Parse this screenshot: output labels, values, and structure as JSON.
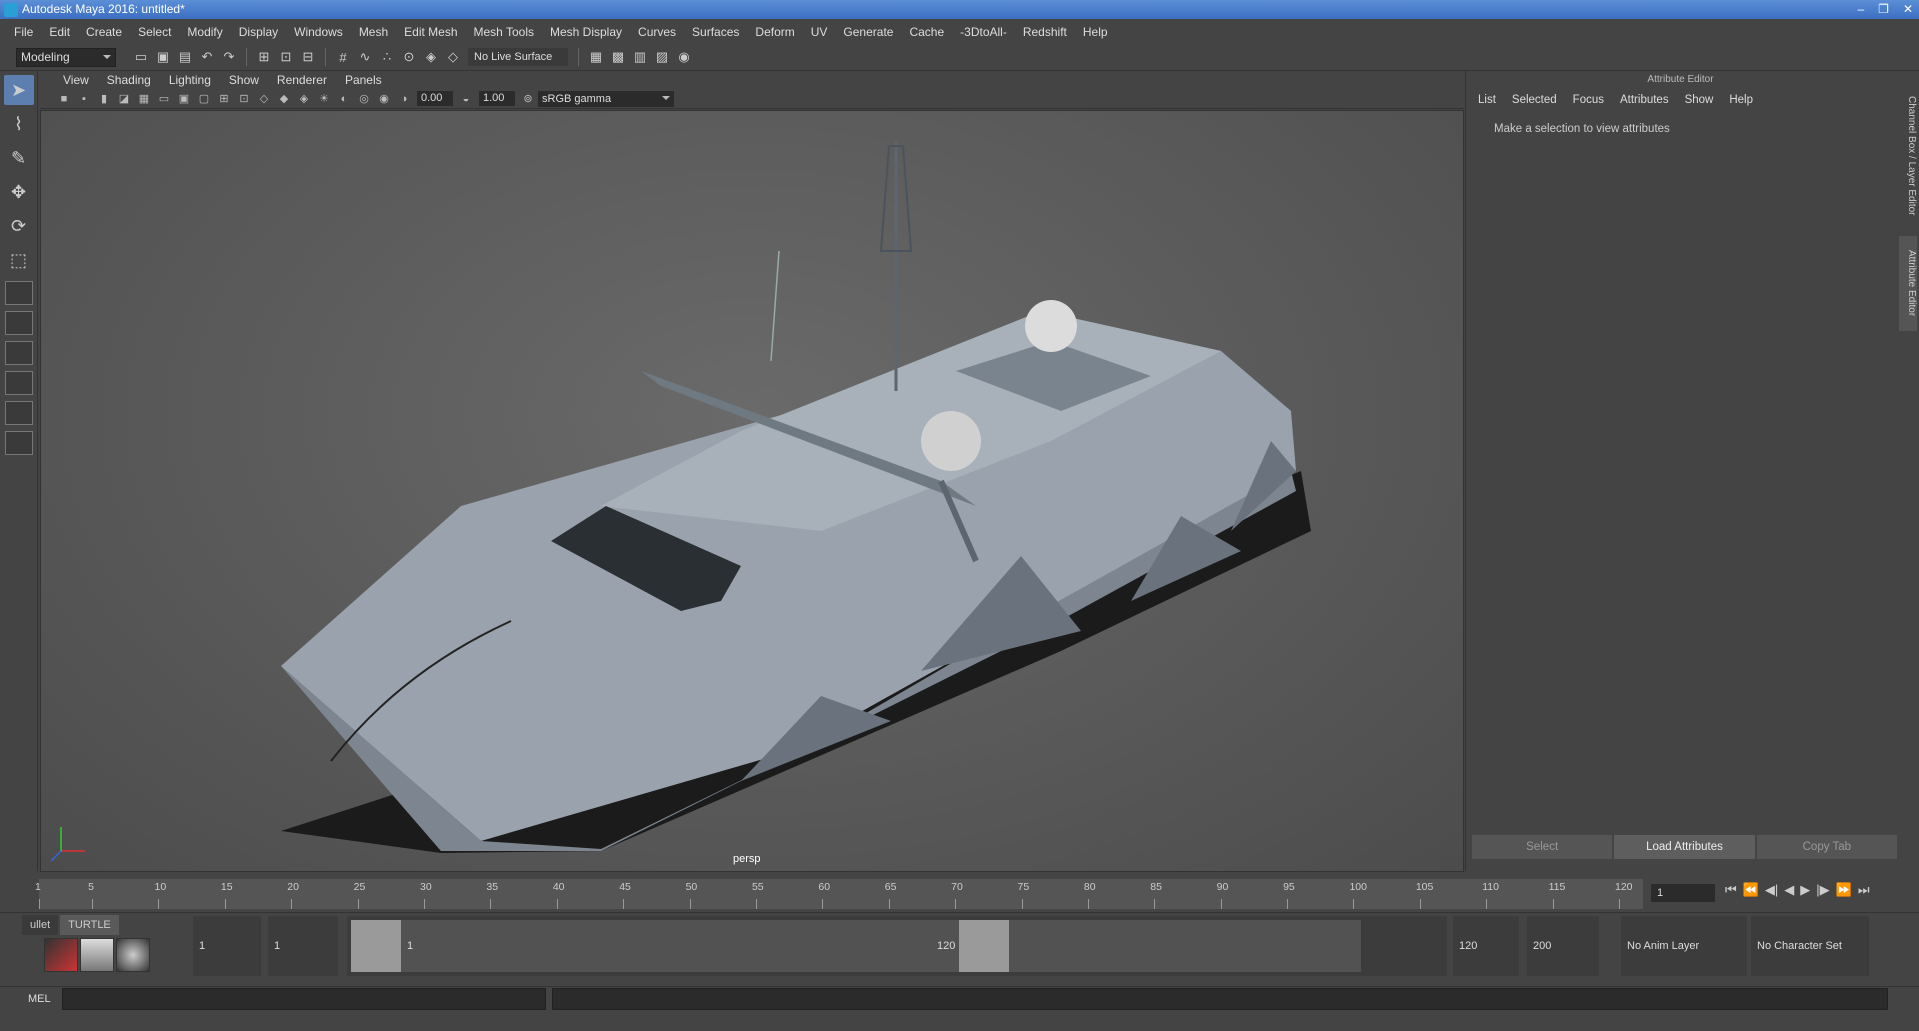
{
  "window": {
    "title": "Autodesk Maya 2016: untitled*",
    "controls": [
      "–",
      "❐",
      "✕"
    ]
  },
  "menubar": [
    "File",
    "Edit",
    "Create",
    "Select",
    "Modify",
    "Display",
    "Windows",
    "Mesh",
    "Edit Mesh",
    "Mesh Tools",
    "Mesh Display",
    "Curves",
    "Surfaces",
    "Deform",
    "UV",
    "Generate",
    "Cache",
    "-3DtoAll-",
    "Redshift",
    "Help"
  ],
  "shelf": {
    "mode": "Modeling",
    "live_surface": "No Live Surface"
  },
  "viewport": {
    "menu": [
      "View",
      "Shading",
      "Lighting",
      "Show",
      "Renderer",
      "Panels"
    ],
    "exposure": "0.00",
    "gamma_value": "1.00",
    "color_space": "sRGB gamma",
    "camera": "persp"
  },
  "attribute_editor": {
    "title": "Attribute Editor",
    "menu": [
      "List",
      "Selected",
      "Focus",
      "Attributes",
      "Show",
      "Help"
    ],
    "message": "Make a selection to view attributes",
    "buttons": [
      "Select",
      "Load Attributes",
      "Copy Tab"
    ]
  },
  "side_tabs": [
    "Channel Box / Layer Editor",
    "Attribute Editor"
  ],
  "timeline": {
    "ticks": [
      "1",
      "5",
      "10",
      "15",
      "20",
      "25",
      "30",
      "35",
      "40",
      "45",
      "50",
      "55",
      "60",
      "65",
      "70",
      "75",
      "80",
      "85",
      "90",
      "95",
      "100",
      "105",
      "110",
      "115",
      "120"
    ],
    "current_frame": "1"
  },
  "range": {
    "start": "1",
    "playback_start": "1",
    "slider_start": "1",
    "slider_end": "120",
    "playback_end": "120",
    "end": "200",
    "anim_layer": "No Anim Layer",
    "character_set": "No Character Set"
  },
  "shelf_tabs": [
    "ullet",
    "TURTLE"
  ],
  "command": {
    "language": "MEL"
  }
}
